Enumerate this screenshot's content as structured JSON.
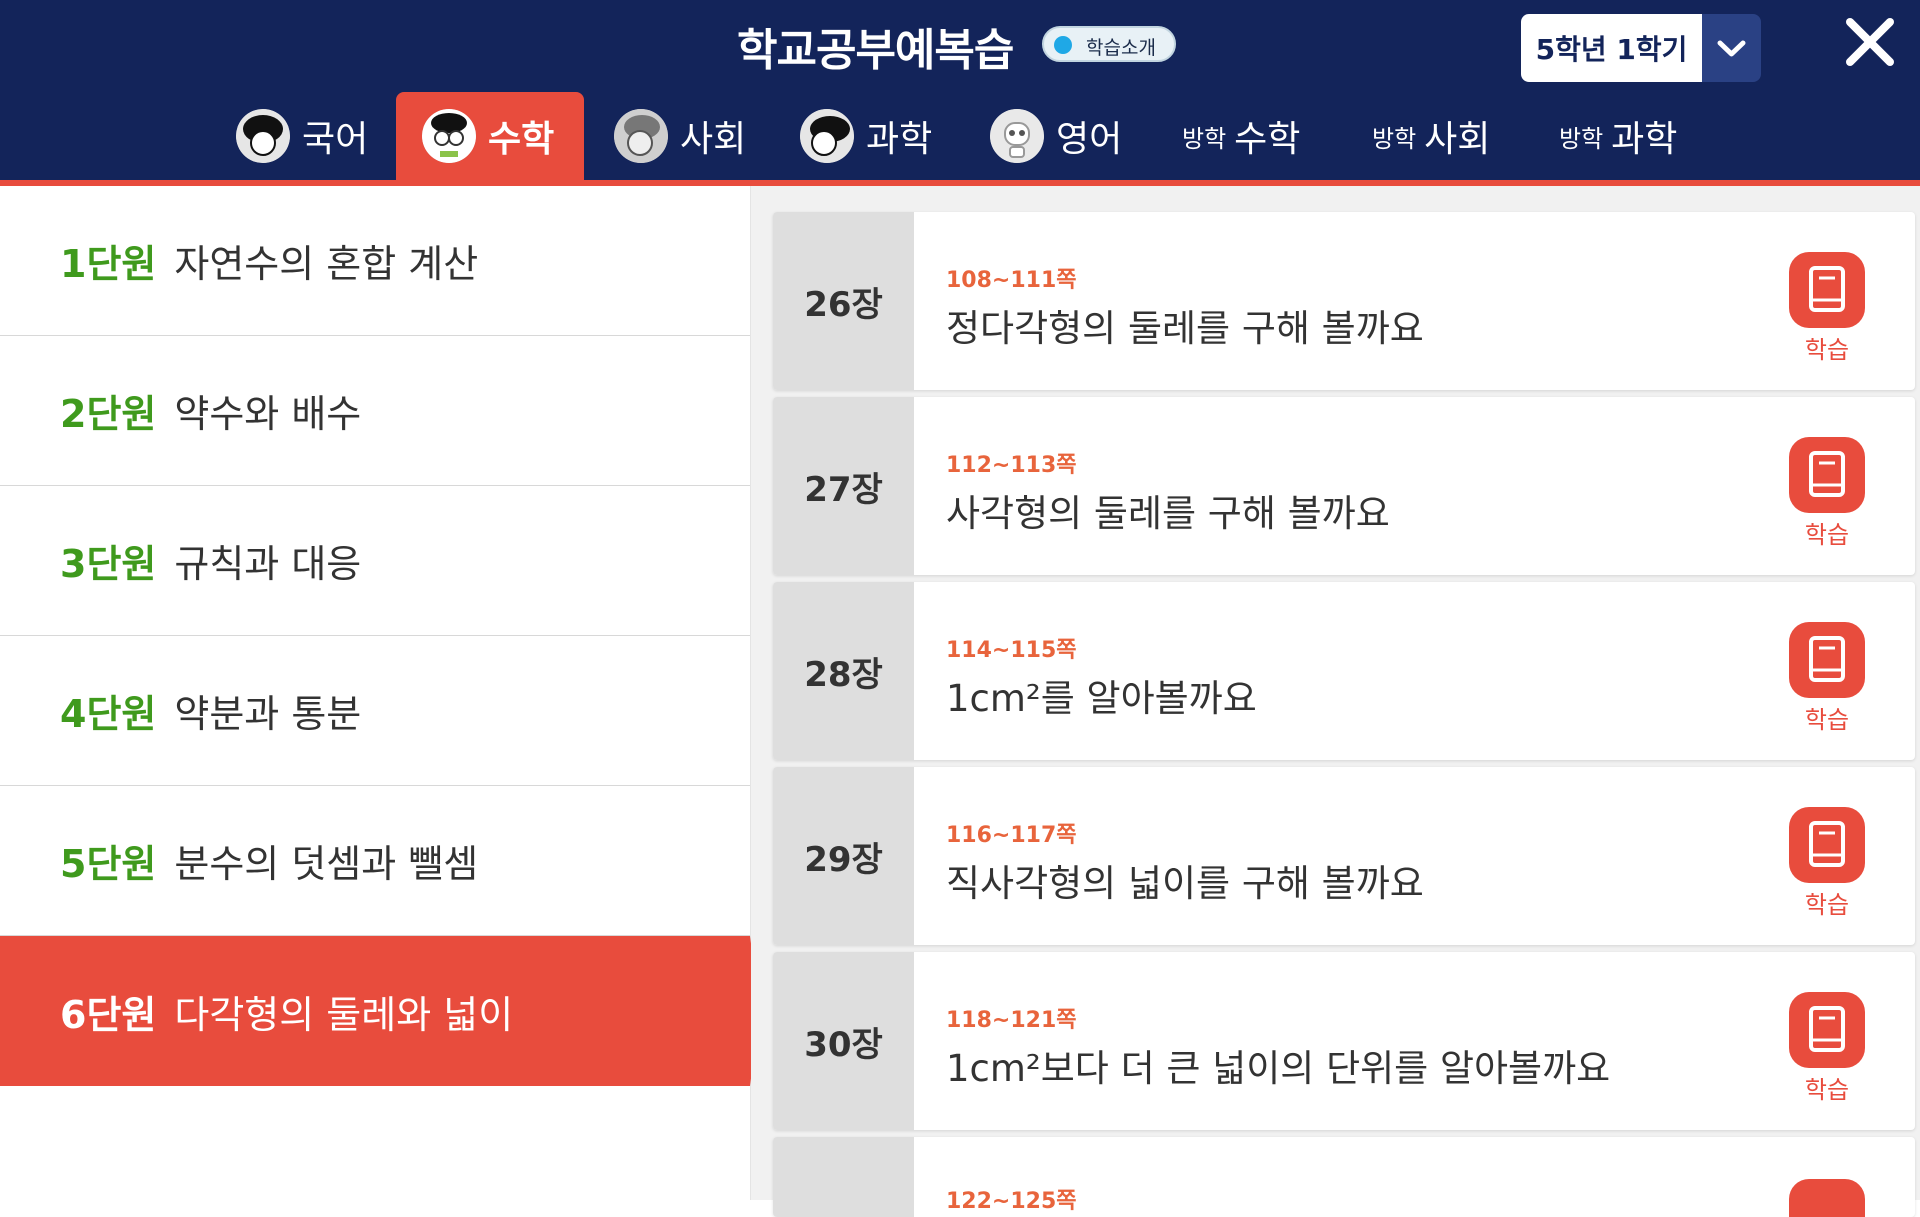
{
  "header": {
    "title": "학교공부예복습",
    "intro_label": "학습소개",
    "grade_select": "5학년 1학기",
    "colors": {
      "navy": "#13245a",
      "accent": "#e84c3d",
      "green": "#3f9a1d",
      "orange": "#e8643c"
    }
  },
  "tabs": [
    {
      "label": "국어",
      "icon": "korean-character-avatar-icon"
    },
    {
      "label": "수학",
      "icon": "math-character-avatar-icon",
      "active": true
    },
    {
      "label": "사회",
      "icon": "social-character-avatar-icon"
    },
    {
      "label": "과학",
      "icon": "science-character-avatar-icon"
    },
    {
      "label": "영어",
      "icon": "english-robot-avatar-icon"
    },
    {
      "prefix": "방학",
      "label": "수학"
    },
    {
      "prefix": "방학",
      "label": "사회"
    },
    {
      "prefix": "방학",
      "label": "과학"
    }
  ],
  "units": [
    {
      "num": "1단원",
      "name": "자연수의 혼합 계산"
    },
    {
      "num": "2단원",
      "name": "약수와 배수"
    },
    {
      "num": "3단원",
      "name": "규칙과 대응"
    },
    {
      "num": "4단원",
      "name": "약분과 통분"
    },
    {
      "num": "5단원",
      "name": "분수의 덧셈과 뺄셈"
    },
    {
      "num": "6단원",
      "name": "다각형의 둘레와 넓이",
      "active": true
    }
  ],
  "chapters": [
    {
      "chapter": "26장",
      "pages": "108~111쪽",
      "title": "정다각형의 둘레를 구해 볼까요",
      "action": "학습"
    },
    {
      "chapter": "27장",
      "pages": "112~113쪽",
      "title": "사각형의 둘레를 구해 볼까요",
      "action": "학습"
    },
    {
      "chapter": "28장",
      "pages": "114~115쪽",
      "title": "1cm²를 알아볼까요",
      "action": "학습"
    },
    {
      "chapter": "29장",
      "pages": "116~117쪽",
      "title": "직사각형의 넓이를 구해 볼까요",
      "action": "학습"
    },
    {
      "chapter": "30장",
      "pages": "118~121쪽",
      "title": "1cm²보다 더 큰 넓이의 단위를 알아볼까요",
      "action": "학습"
    },
    {
      "chapter": "",
      "pages": "122~125쪽",
      "title": "",
      "action": ""
    }
  ]
}
